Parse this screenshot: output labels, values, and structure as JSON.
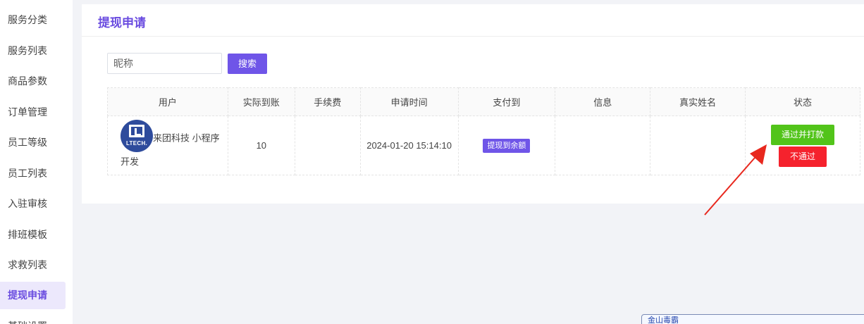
{
  "sidebar": {
    "items": [
      {
        "label": "服务分类",
        "active": false
      },
      {
        "label": "服务列表",
        "active": false
      },
      {
        "label": "商品参数",
        "active": false
      },
      {
        "label": "订单管理",
        "active": false
      },
      {
        "label": "员工等级",
        "active": false
      },
      {
        "label": "员工列表",
        "active": false
      },
      {
        "label": "入驻审核",
        "active": false
      },
      {
        "label": "排班模板",
        "active": false
      },
      {
        "label": "求救列表",
        "active": false
      },
      {
        "label": "提现申请",
        "active": true
      },
      {
        "label": "基础设置",
        "active": false
      }
    ]
  },
  "page": {
    "title": "提现申请"
  },
  "search": {
    "placeholder": "昵称",
    "button_label": "搜索"
  },
  "table": {
    "headers": [
      "用户",
      "实际到账",
      "手续费",
      "申请时间",
      "支付到",
      "信息",
      "真实姓名",
      "状态"
    ],
    "rows": [
      {
        "avatar_text": "LTECH.",
        "user": "来团科技 小程序开发",
        "amount": "10",
        "fee": "",
        "time": "2024-01-20 15:14:10",
        "pay_to": "提现到余额",
        "info": "",
        "real_name": "",
        "approve_label": "通过并打款",
        "reject_label": "不通过"
      }
    ]
  },
  "widget": {
    "label": "金山毒霸"
  },
  "colors": {
    "accent": "#6f55e8",
    "approve": "#52c41a",
    "reject": "#f5222d",
    "annotation_arrow": "#e8281e"
  }
}
